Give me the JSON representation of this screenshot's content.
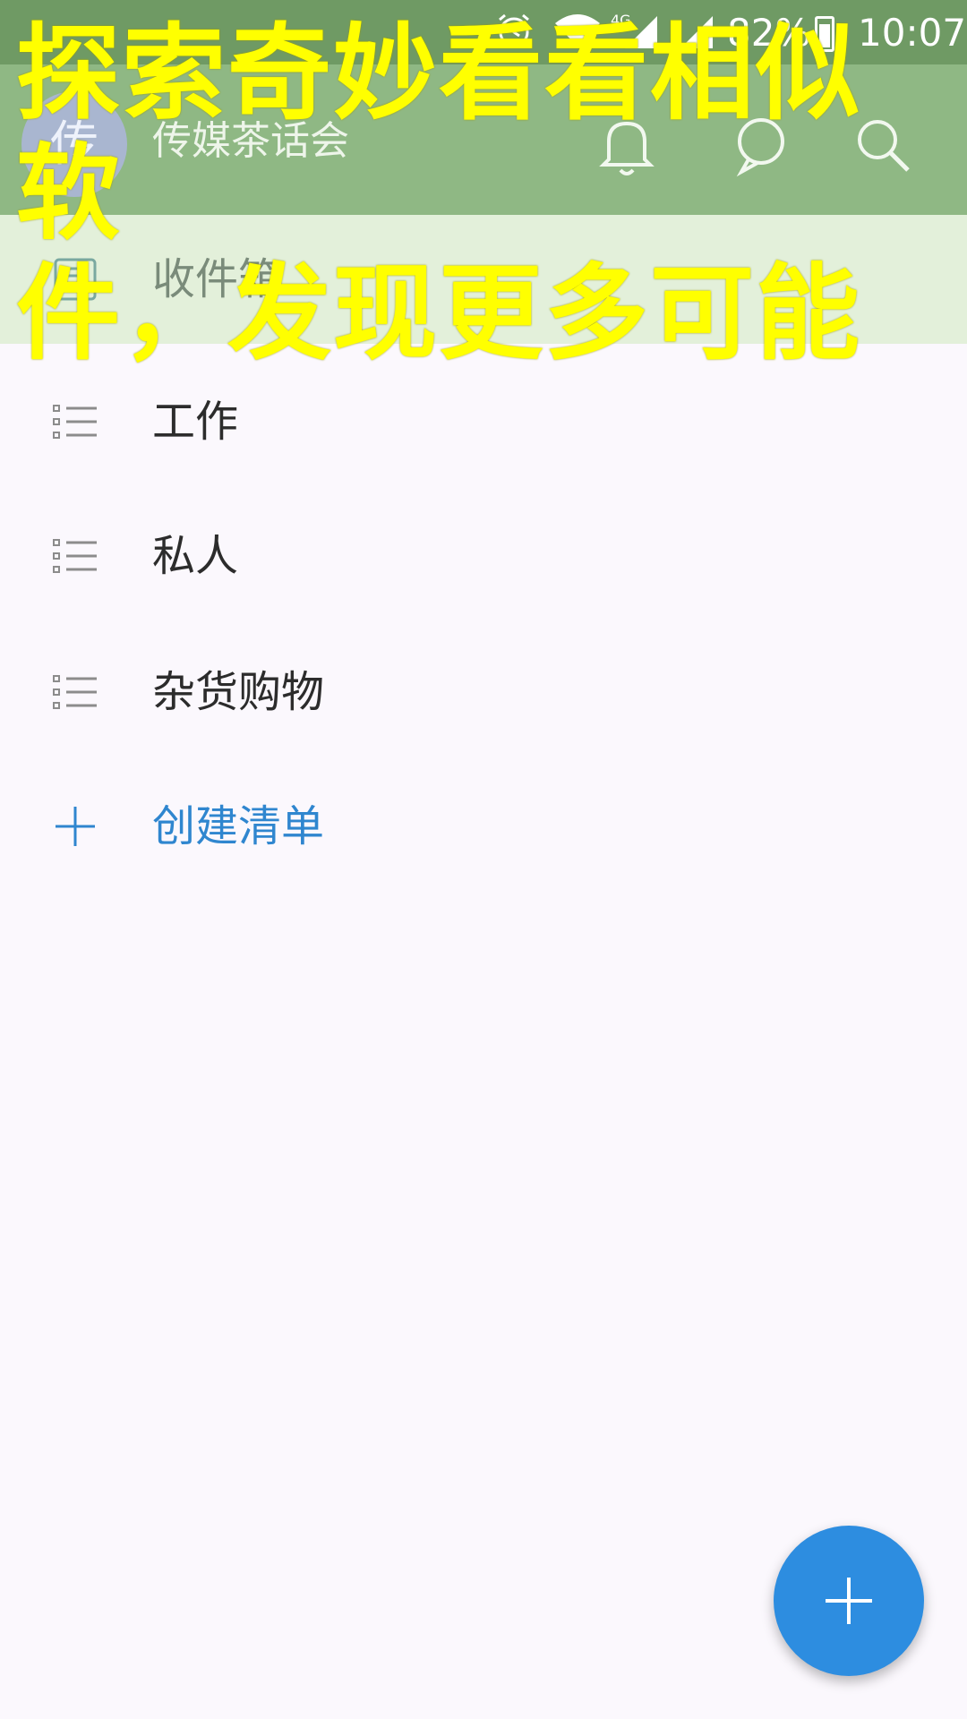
{
  "status_bar": {
    "sim_label": "4G",
    "battery": "82%",
    "time": "10:07"
  },
  "app_bar": {
    "avatar_text": "传",
    "title": "传媒茶话会",
    "icons": [
      "bell-icon",
      "chat-icon",
      "search-icon"
    ]
  },
  "inbox": {
    "label": "收件箱",
    "icon": "inbox-icon"
  },
  "lists": [
    {
      "label": "工作",
      "icon": "list-icon"
    },
    {
      "label": "私人",
      "icon": "list-icon"
    },
    {
      "label": "杂货购物",
      "icon": "list-icon"
    }
  ],
  "create_list": {
    "label": "创建清单",
    "icon": "plus-icon"
  },
  "promo": {
    "line1": "探索奇妙看看相似软",
    "line2": "件，发现更多可能"
  },
  "fab": {
    "icon": "plus-icon"
  },
  "colors": {
    "status_bar": "#6f9a64",
    "app_bar": "#8fb884",
    "inbox_highlight": "#e3f0da",
    "accent": "#2f86cf",
    "fab": "#2d8de0",
    "promo_text": "#ffff00"
  }
}
